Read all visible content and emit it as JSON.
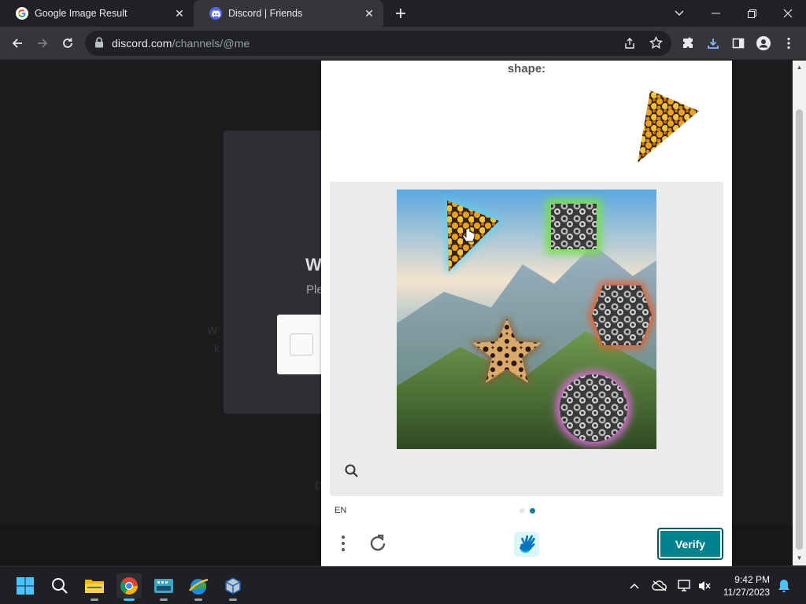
{
  "browser": {
    "tabs": [
      {
        "title": "Google Image Result",
        "active": false,
        "favicon": "google-g-icon"
      },
      {
        "title": "Discord | Friends",
        "active": true,
        "favicon": "discord-icon"
      }
    ],
    "new_tab_icon": "plus-icon",
    "url_host": "discord.com",
    "url_path": "/channels/@me"
  },
  "discord_modal": {
    "heading": "W",
    "subtext": "Ple",
    "ghost_text_1": "W",
    "ghost_text_2": "k",
    "ghost_text_3": "D"
  },
  "captcha": {
    "prompt": "shape:",
    "language": "EN",
    "page_dots": [
      false,
      true
    ],
    "verify_label": "Verify",
    "accent_color": "#00838f"
  },
  "taskbar": {
    "time": "9:42 PM",
    "date": "11/27/2023",
    "apps": [
      "windows-start-icon",
      "search-icon",
      "file-explorer-icon",
      "chrome-icon",
      "keyboard-app-icon",
      "globe-app-icon",
      "virtualbox-icon"
    ]
  }
}
